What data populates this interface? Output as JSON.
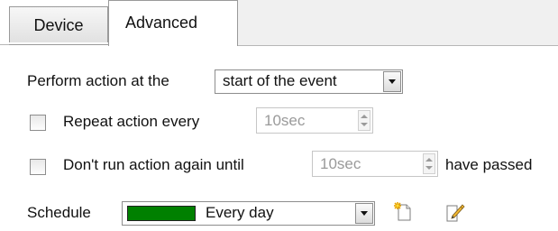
{
  "tabs": [
    {
      "label": "Device"
    },
    {
      "label": "Advanced"
    }
  ],
  "perform": {
    "label": "Perform action at the",
    "selected": "start of the event"
  },
  "repeat": {
    "label": "Repeat action every",
    "value": "10sec",
    "checked": false
  },
  "dont_run": {
    "label": "Don't run action again until",
    "value": "10sec",
    "suffix": "have passed",
    "checked": false
  },
  "schedule": {
    "label": "Schedule",
    "selected": "Every day",
    "swatch_color": "#008000"
  },
  "icons": {
    "new_schedule": "new-document-icon",
    "edit_schedule": "edit-pencil-icon"
  }
}
